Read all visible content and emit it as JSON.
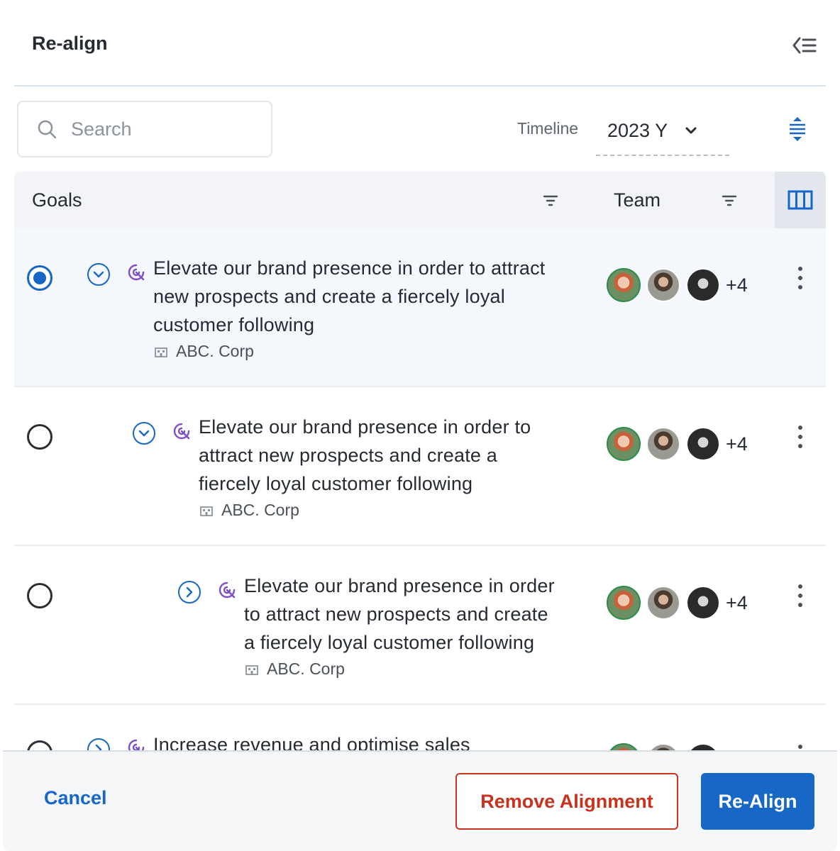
{
  "panel": {
    "title": "Re-align"
  },
  "search": {
    "placeholder": "Search",
    "value": ""
  },
  "timeline": {
    "label": "Timeline",
    "value": "2023 Y"
  },
  "table": {
    "columns": {
      "goals": "Goals",
      "team": "Team"
    }
  },
  "rows": [
    {
      "goal": "Elevate our brand presence in order to attract new prospects and create a fiercely loyal customer following",
      "lines": [
        "Elevate our brand presence in order to attract",
        "new prospects and create a fiercely loyal",
        "customer following"
      ],
      "org": "ABC. Corp",
      "team_more": "+4",
      "selected": true,
      "expanded": true,
      "level": 0
    },
    {
      "goal": "Elevate our brand presence in order to attract new prospects and create a fiercely loyal customer following",
      "lines": [
        "Elevate our brand presence in order to",
        "attract new prospects and create a",
        "fiercely loyal customer following"
      ],
      "org": "ABC. Corp",
      "team_more": "+4",
      "selected": false,
      "expanded": true,
      "level": 1
    },
    {
      "goal": "Elevate our brand presence in order to attract new prospects and create a fiercely loyal customer following",
      "lines": [
        "Elevate our brand presence in order",
        "to attract new prospects and create",
        "a fiercely loyal customer following"
      ],
      "org": "ABC. Corp",
      "team_more": "+4",
      "selected": false,
      "expanded": false,
      "level": 2
    },
    {
      "goal": "Increase revenue and optimise sales",
      "lines": [
        "Increase revenue and optimise sales"
      ],
      "org": "",
      "team_more": "",
      "selected": false,
      "expanded": false,
      "level": 0
    }
  ],
  "footer": {
    "cancel_label": "Cancel",
    "remove_label": "Remove Alignment",
    "realign_label": "Re-Align"
  },
  "colors": {
    "primary": "#1767c6",
    "danger": "#c8321e",
    "goal_icon": "#7b4fc9"
  },
  "icons": [
    "collapse-panel-icon",
    "search-icon",
    "chevron-down-icon",
    "row-density-icon",
    "filter-icon",
    "columns-icon",
    "chevron-circle-icon",
    "goal-target-icon",
    "building-icon",
    "kebab-icon"
  ]
}
